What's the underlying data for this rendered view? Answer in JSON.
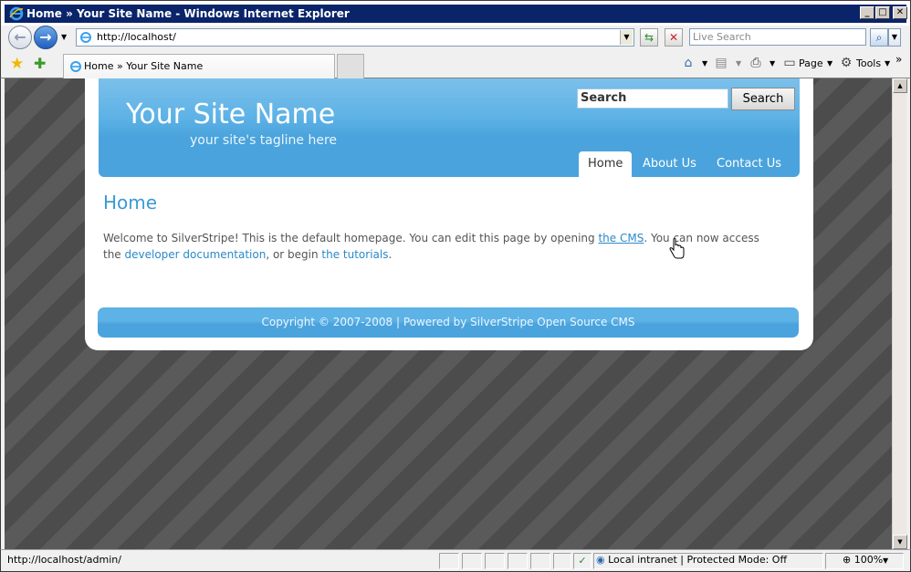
{
  "window": {
    "title": "Home » Your Site Name - Windows Internet Explorer",
    "controls": {
      "minimize": "_",
      "maximize": "□",
      "close": "✕"
    }
  },
  "address_bar": {
    "url": "http://localhost/",
    "live_search_placeholder": "Live Search"
  },
  "tab": {
    "title": "Home » Your Site Name"
  },
  "command_bar": {
    "page_label": "Page",
    "tools_label": "Tools"
  },
  "site": {
    "name": "Your Site Name",
    "tagline": "your site's tagline here",
    "search_placeholder": "Search",
    "search_button": "Search",
    "nav": [
      {
        "label": "Home",
        "active": true
      },
      {
        "label": "About Us",
        "active": false
      },
      {
        "label": "Contact Us",
        "active": false
      }
    ]
  },
  "content": {
    "title": "Home",
    "text_1": "Welcome to SilverStripe! This is the default homepage. You can edit this page by opening ",
    "link_cms": "the CMS",
    "text_2": ". You can now access the ",
    "link_docs": "developer documentation",
    "text_3": ", or begin ",
    "link_tutorials": "the tutorials",
    "text_4": "."
  },
  "footer": {
    "text": "Copyright © 2007-2008 | Powered by SilverStripe Open Source CMS"
  },
  "status_bar": {
    "url": "http://localhost/admin/",
    "zone": "Local intranet | Protected Mode: Off",
    "zoom": "100%"
  },
  "colors": {
    "header_blue": "#5db2e6",
    "link_blue": "#2a8ac8",
    "title_bar": "#0a246a"
  }
}
